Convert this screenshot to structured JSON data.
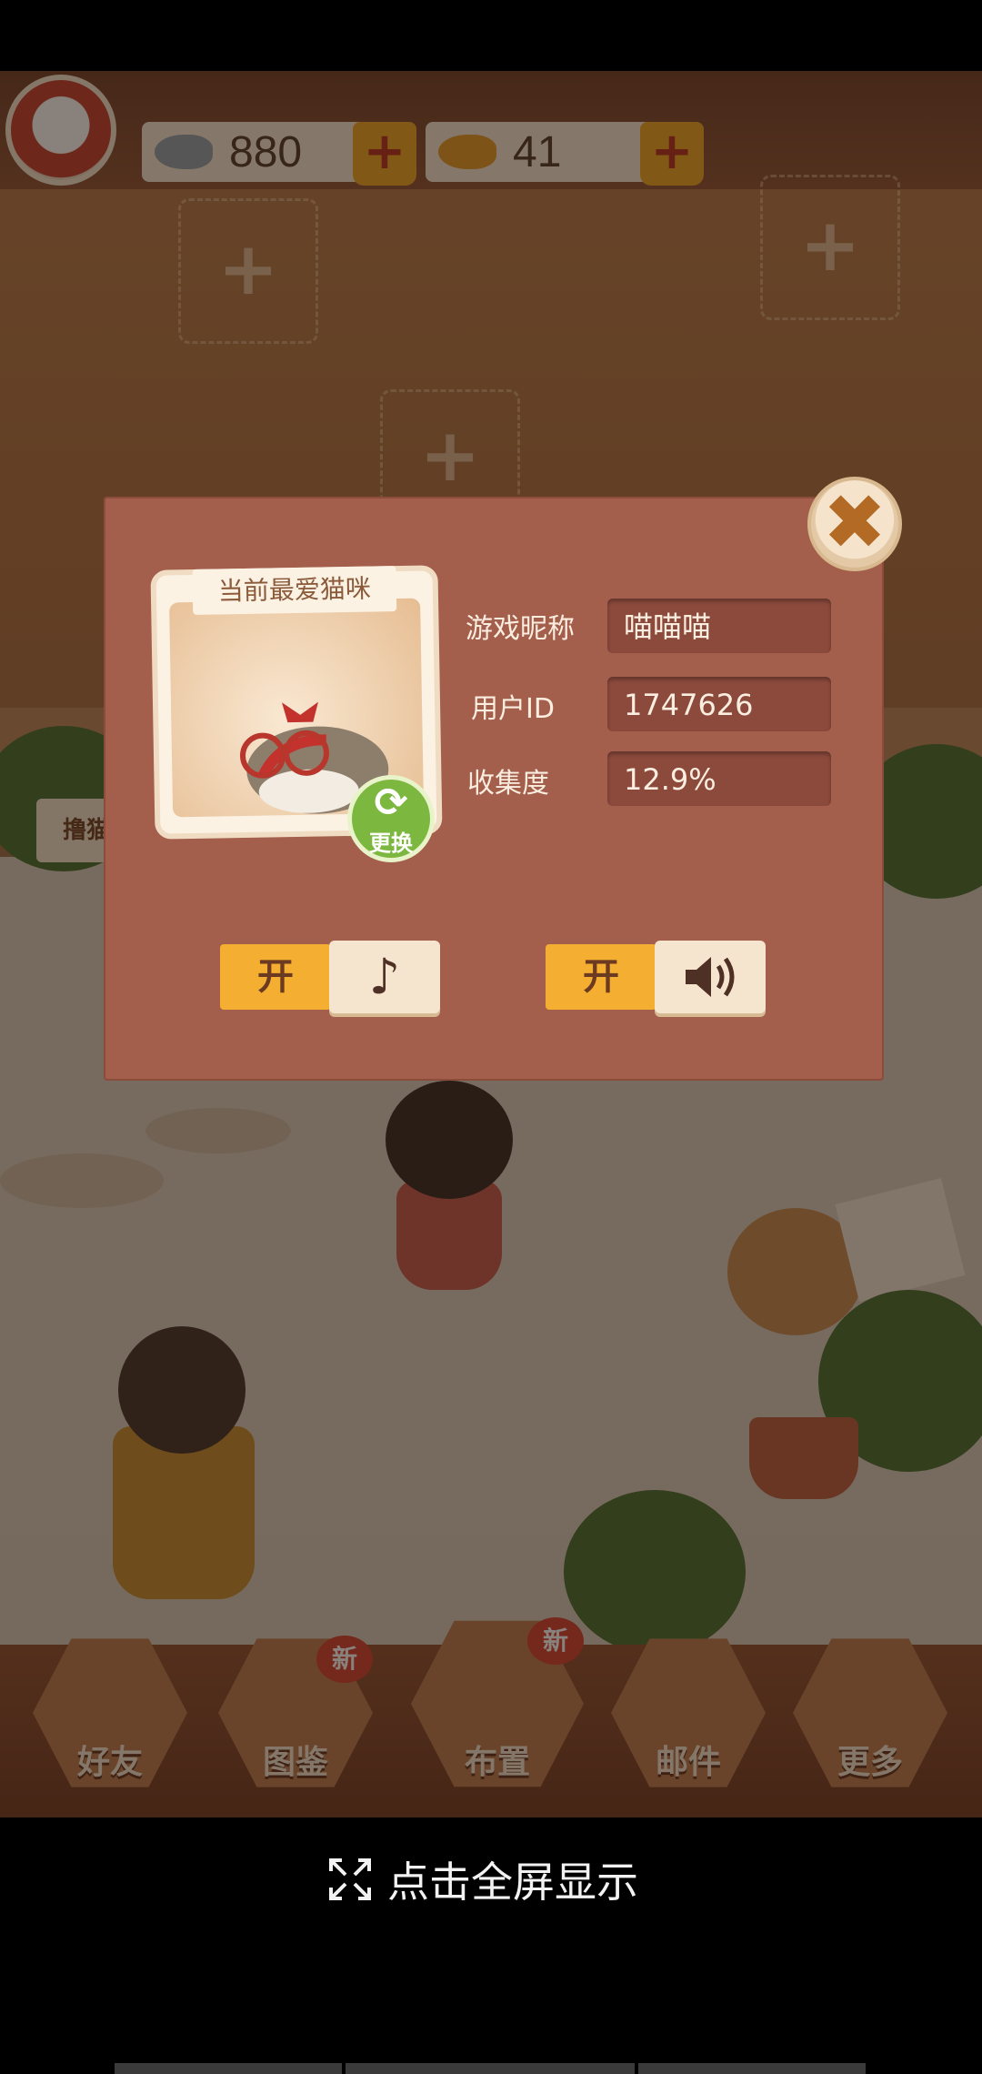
{
  "currency": {
    "fish_silver": {
      "value": "880",
      "add": "+"
    },
    "fish_gold": {
      "value": "41",
      "add": "+"
    }
  },
  "slots": {
    "plus": "+"
  },
  "nav": [
    {
      "label": "好友",
      "badge": ""
    },
    {
      "label": "图鉴",
      "badge": "新"
    },
    {
      "label": "布置",
      "badge": "新"
    },
    {
      "label": "邮件",
      "badge": ""
    },
    {
      "label": "更多",
      "badge": ""
    }
  ],
  "scene": {
    "book_label": "撸猫"
  },
  "dialog": {
    "close": "✖",
    "card_title": "当前最爱猫咪",
    "change_label": "更换",
    "change_icon": "refresh-icon",
    "nickname_label": "游戏昵称",
    "nickname_value": "喵喵喵",
    "userid_label": "用户ID",
    "userid_value": "1747626",
    "collection_label": "收集度",
    "collection_value": "12.9%",
    "music_state": "开",
    "music_icon": "♪",
    "sound_state": "开",
    "sound_icon": "speaker-icon"
  },
  "fullscreen": {
    "label": "点击全屏显示",
    "icon": "expand-icon"
  }
}
